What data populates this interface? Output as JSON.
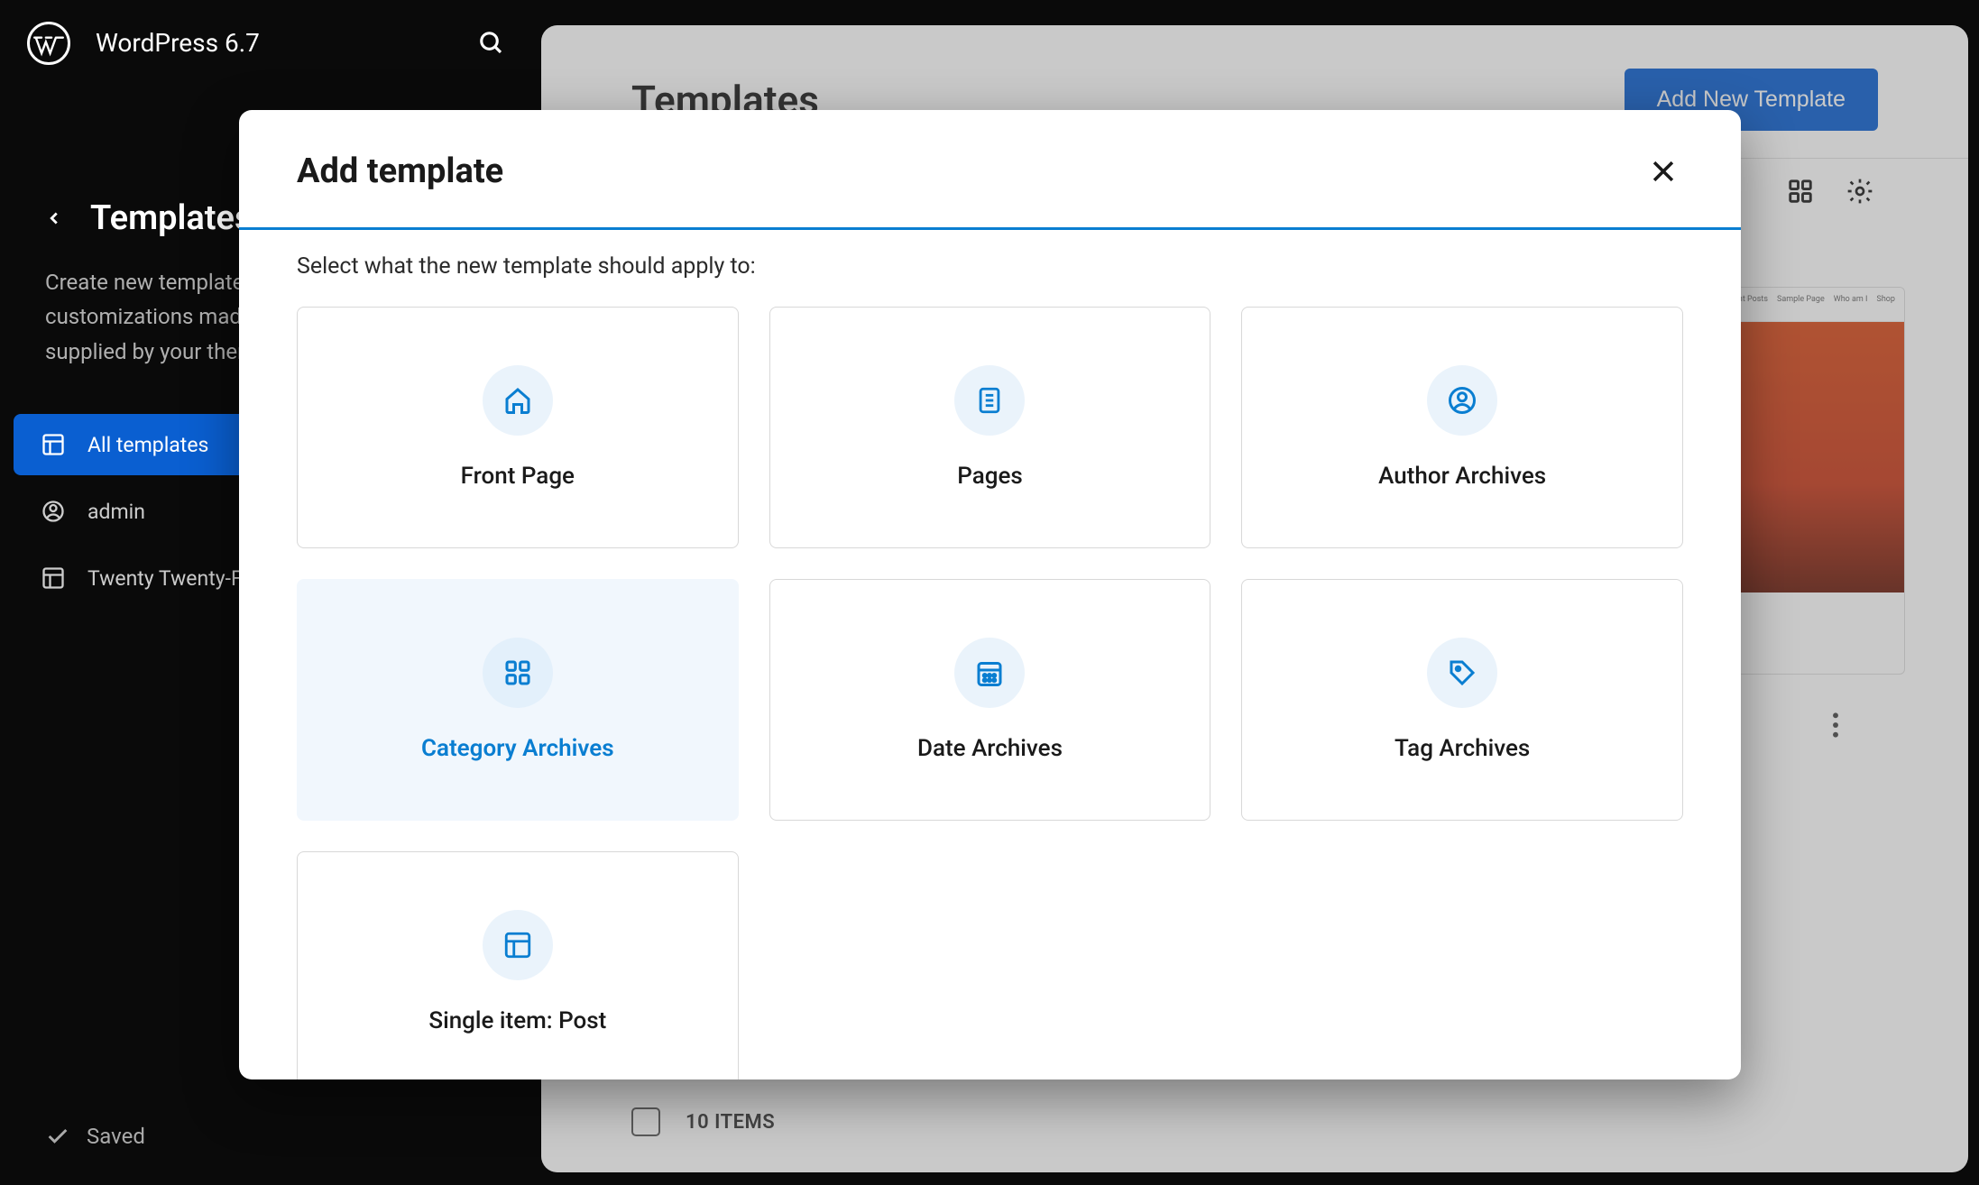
{
  "header": {
    "site_title": "WordPress 6.7"
  },
  "sidebar": {
    "title": "Templates",
    "description": "Create new templates, or reset any customizations made to the templates supplied by your theme.",
    "items": [
      {
        "label": "All templates",
        "icon": "layout-icon",
        "active": true
      },
      {
        "label": "admin",
        "icon": "user-icon",
        "active": false
      },
      {
        "label": "Twenty Twenty-Four",
        "icon": "layout-icon",
        "active": false
      }
    ]
  },
  "saved_label": "Saved",
  "main": {
    "title": "Templates",
    "add_button": "Add New Template",
    "preview_tabs": [
      "Recent Posts",
      "Sample Page",
      "Who am I",
      "Shop"
    ],
    "item_count_label": "10 ITEMS"
  },
  "modal": {
    "title": "Add template",
    "prompt": "Select what the new template should apply to:",
    "options": [
      {
        "label": "Front Page",
        "icon": "home",
        "selected": false
      },
      {
        "label": "Pages",
        "icon": "page",
        "selected": false
      },
      {
        "label": "Author Archives",
        "icon": "user",
        "selected": false
      },
      {
        "label": "Category Archives",
        "icon": "grid",
        "selected": true
      },
      {
        "label": "Date Archives",
        "icon": "calendar",
        "selected": false
      },
      {
        "label": "Tag Archives",
        "icon": "tag",
        "selected": false
      },
      {
        "label": "Single item: Post",
        "icon": "single",
        "selected": false
      }
    ]
  }
}
